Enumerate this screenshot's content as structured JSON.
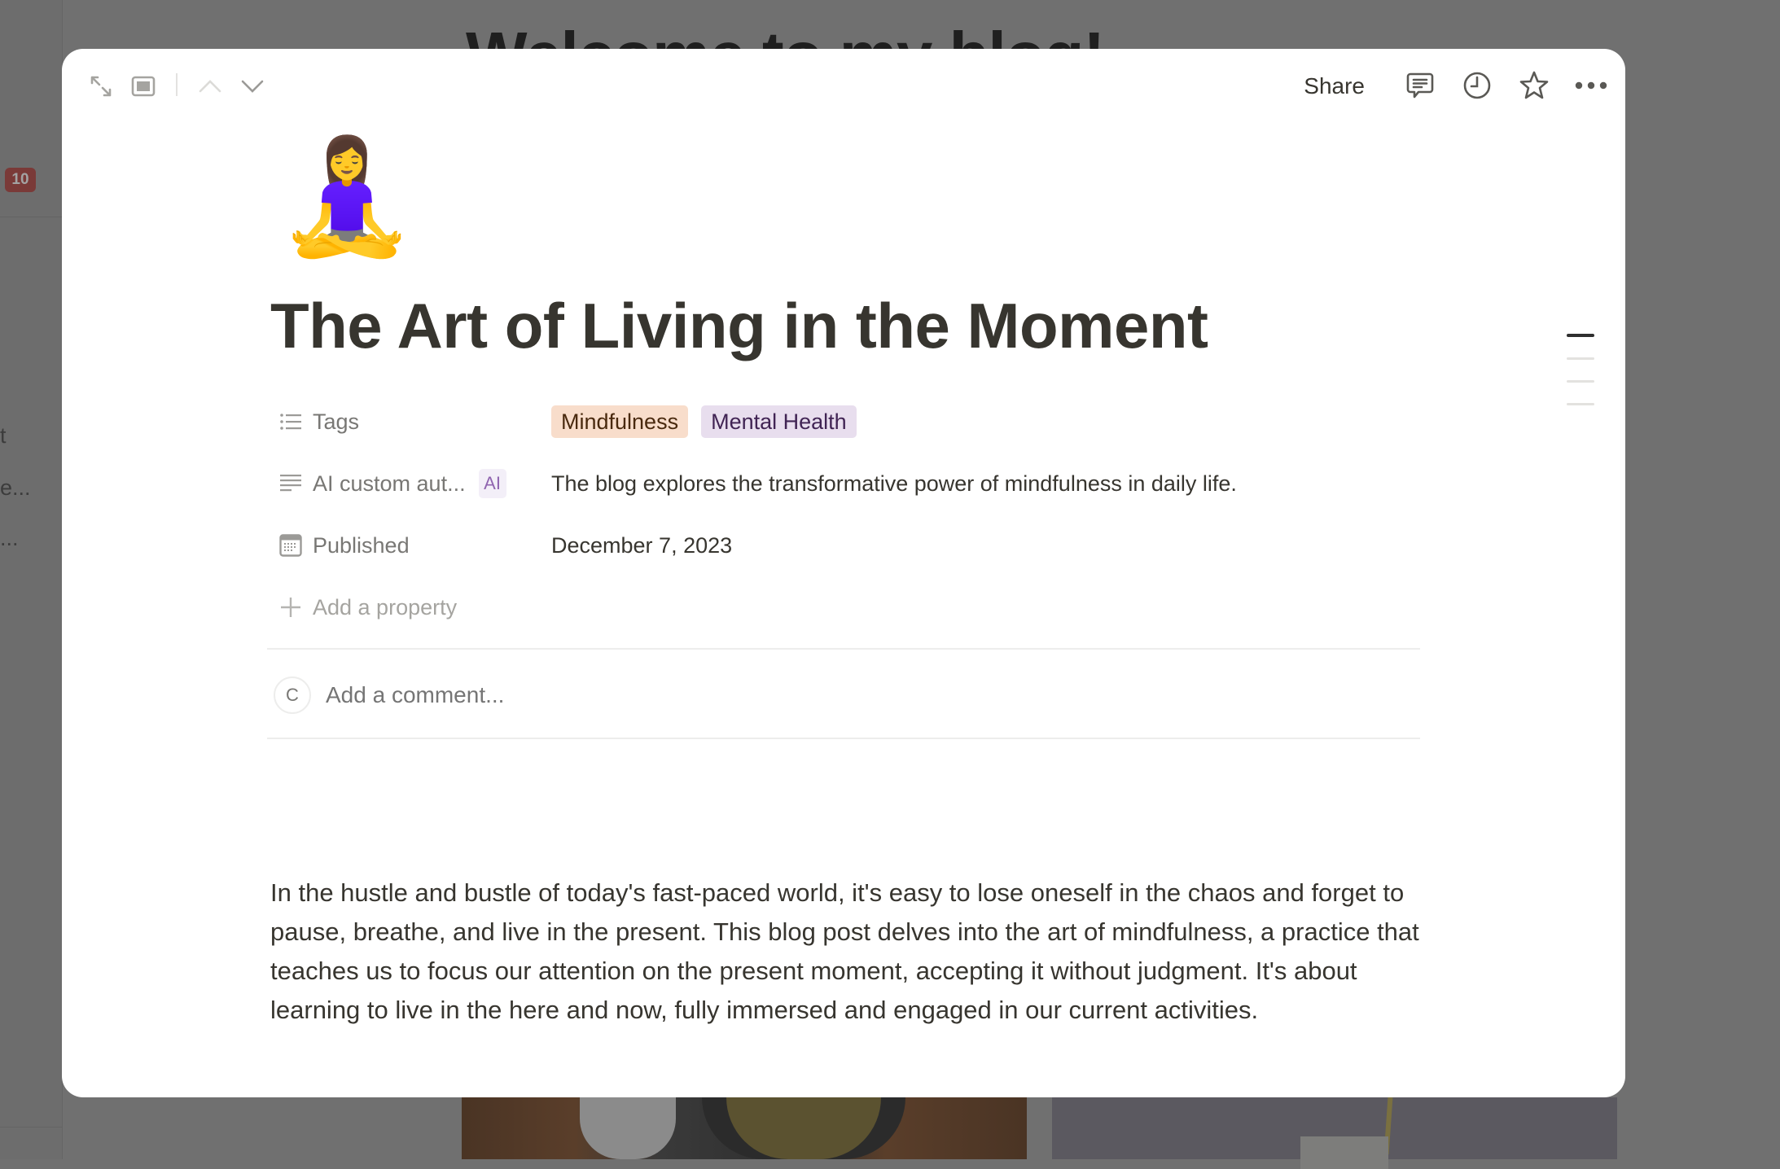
{
  "background": {
    "title": "Welcome to my blog!",
    "badge_count": "10",
    "sidebar_fragments": [
      "t",
      "e...",
      "..."
    ]
  },
  "modal": {
    "toolbar": {
      "left_icons": [
        "expand-icon",
        "peek-mode-icon",
        "previous-page-icon",
        "next-page-icon"
      ],
      "share_label": "Share",
      "right_icons": [
        "comments-icon",
        "updates-clock-icon",
        "favorite-star-icon",
        "more-options-icon"
      ]
    },
    "page": {
      "icon_emoji": "🧘‍♀️",
      "title": "The Art of Living in the Moment",
      "properties": [
        {
          "name": "Tags",
          "icon": "multi-select-list-icon",
          "type": "multi_select",
          "tags": [
            {
              "label": "Mindfulness",
              "bg": "#F8DDCB",
              "fg": "#49290E"
            },
            {
              "label": "Mental Health",
              "bg": "#E8DEEE",
              "fg": "#412454"
            }
          ]
        },
        {
          "name": "AI custom aut...",
          "icon": "text-lines-icon",
          "type": "ai_autofill",
          "badge": "AI",
          "value": "The blog explores the transformative power of mindfulness in daily life."
        },
        {
          "name": "Published",
          "icon": "calendar-icon",
          "type": "date",
          "value": "December 7, 2023"
        }
      ],
      "add_property_label": "Add a property",
      "comment": {
        "avatar_initial": "C",
        "placeholder": "Add a comment..."
      },
      "toc_items": 4,
      "toc_active_index": 0,
      "body": "In the hustle and bustle of today's fast-paced world, it's easy to lose oneself in the chaos and forget to pause, breathe, and live in the present. This blog post delves into the art of mindfulness, a practice that teaches us to focus our attention on the present moment, accepting it without judgment. It's about learning to live in the here and now, fully immersed and engaged in our current activities."
    }
  },
  "colors": {
    "text_primary": "#37352F",
    "text_secondary": "#787774",
    "text_placeholder": "#A5A4A0",
    "overlay": "#707070",
    "ai_badge_text": "#9065B0"
  }
}
